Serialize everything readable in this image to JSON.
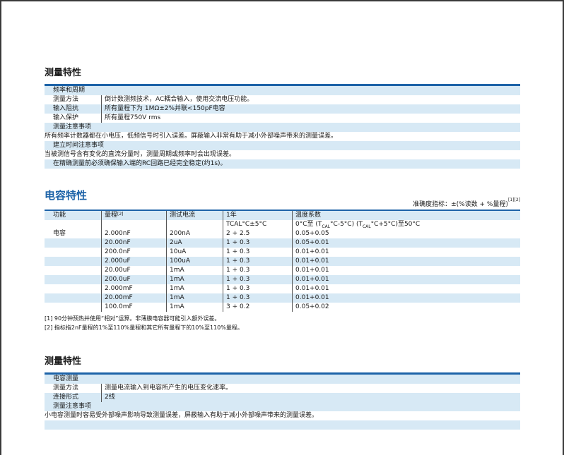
{
  "section1": {
    "title": "测量特性",
    "group_header": "频率和周期",
    "rows": [
      {
        "label": "测量方法",
        "value": "倒计数测频技术，AC耦合输入，使用交流电压功能。"
      },
      {
        "label": "输入阻抗",
        "value": "所有量程下为 1MΩ±2%并联<150pF电容"
      },
      {
        "label": "输入保护",
        "value": "所有量程750V rms"
      }
    ],
    "notes_header": "测量注意事项",
    "notes": [
      "所有频率计数器都在小电压，低频信号时引入误差。屏蔽输入非常有助于减小外部噪声带来的测量误差。"
    ],
    "settle_header": "建立时间注意事项",
    "settle_notes": [
      "当被测信号含有变化的直流分量时，测量周期或频率时会出现误差。",
      "在精确测量前必须确保输入端的RC回路已经完全稳定(约1s)。"
    ]
  },
  "section2": {
    "title": "电容特性",
    "accuracy_label": "准确度指标：±(%读数 + %量程)",
    "accuracy_sup": "[1][2]",
    "headers": {
      "function": "功能",
      "range": "量程",
      "range_sup": "[2]",
      "current": "测试电流",
      "year": "1年",
      "tempco": "温度系数"
    },
    "subheaders": {
      "year": "TCAL°C±5°C",
      "tempco_a": "0°C至 (T",
      "tempco_sub1": "CAL",
      "tempco_b": "°C-5°C) (T",
      "tempco_sub2": "CAL",
      "tempco_c": "°C+5°C)至50°C"
    },
    "function_name": "电容",
    "rows": [
      {
        "range": "2.000nF",
        "current": "200nA",
        "year": "2 + 2.5",
        "tempco": "0.05+0.05"
      },
      {
        "range": "20.00nF",
        "current": "2uA",
        "year": "1 + 0.3",
        "tempco": "0.05+0.01"
      },
      {
        "range": "200.0nF",
        "current": "10uA",
        "year": "1 + 0.3",
        "tempco": "0.01+0.01"
      },
      {
        "range": "2.000uF",
        "current": "100uA",
        "year": "1 + 0.3",
        "tempco": "0.01+0.01"
      },
      {
        "range": "20.00uF",
        "current": "1mA",
        "year": "1 + 0.3",
        "tempco": "0.01+0.01"
      },
      {
        "range": "200.0uF",
        "current": "1mA",
        "year": "1 + 0.3",
        "tempco": "0.01+0.01"
      },
      {
        "range": "2.000mF",
        "current": "1mA",
        "year": "1 + 0.3",
        "tempco": "0.01+0.01"
      },
      {
        "range": "20.00mF",
        "current": "1mA",
        "year": "1 + 0.3",
        "tempco": "0.01+0.01"
      },
      {
        "range": "100.0mF",
        "current": "1mA",
        "year": "3 + 0.2",
        "tempco": "0.05+0.02"
      }
    ],
    "footnotes": [
      "[1] 90分钟预热并使用“相对”运算。非薄膜电容器可能引入额外误差。",
      "[2] 指标指2nF量程的1%至110%量程和其它所有量程下的10%至110%量程。"
    ]
  },
  "section3": {
    "title": "测量特性",
    "group_header": "电容测量",
    "rows": [
      {
        "label": "测量方法",
        "value": "测量电流输入到电容所产生的电压变化速率。"
      },
      {
        "label": "连接形式",
        "value": "2线"
      }
    ],
    "notes_header": "测量注意事项",
    "notes": [
      "小电容测量时容易受外部噪声影响导致测量误差，屏蔽输入有助于减小外部噪声带来的测量误差。"
    ]
  }
}
